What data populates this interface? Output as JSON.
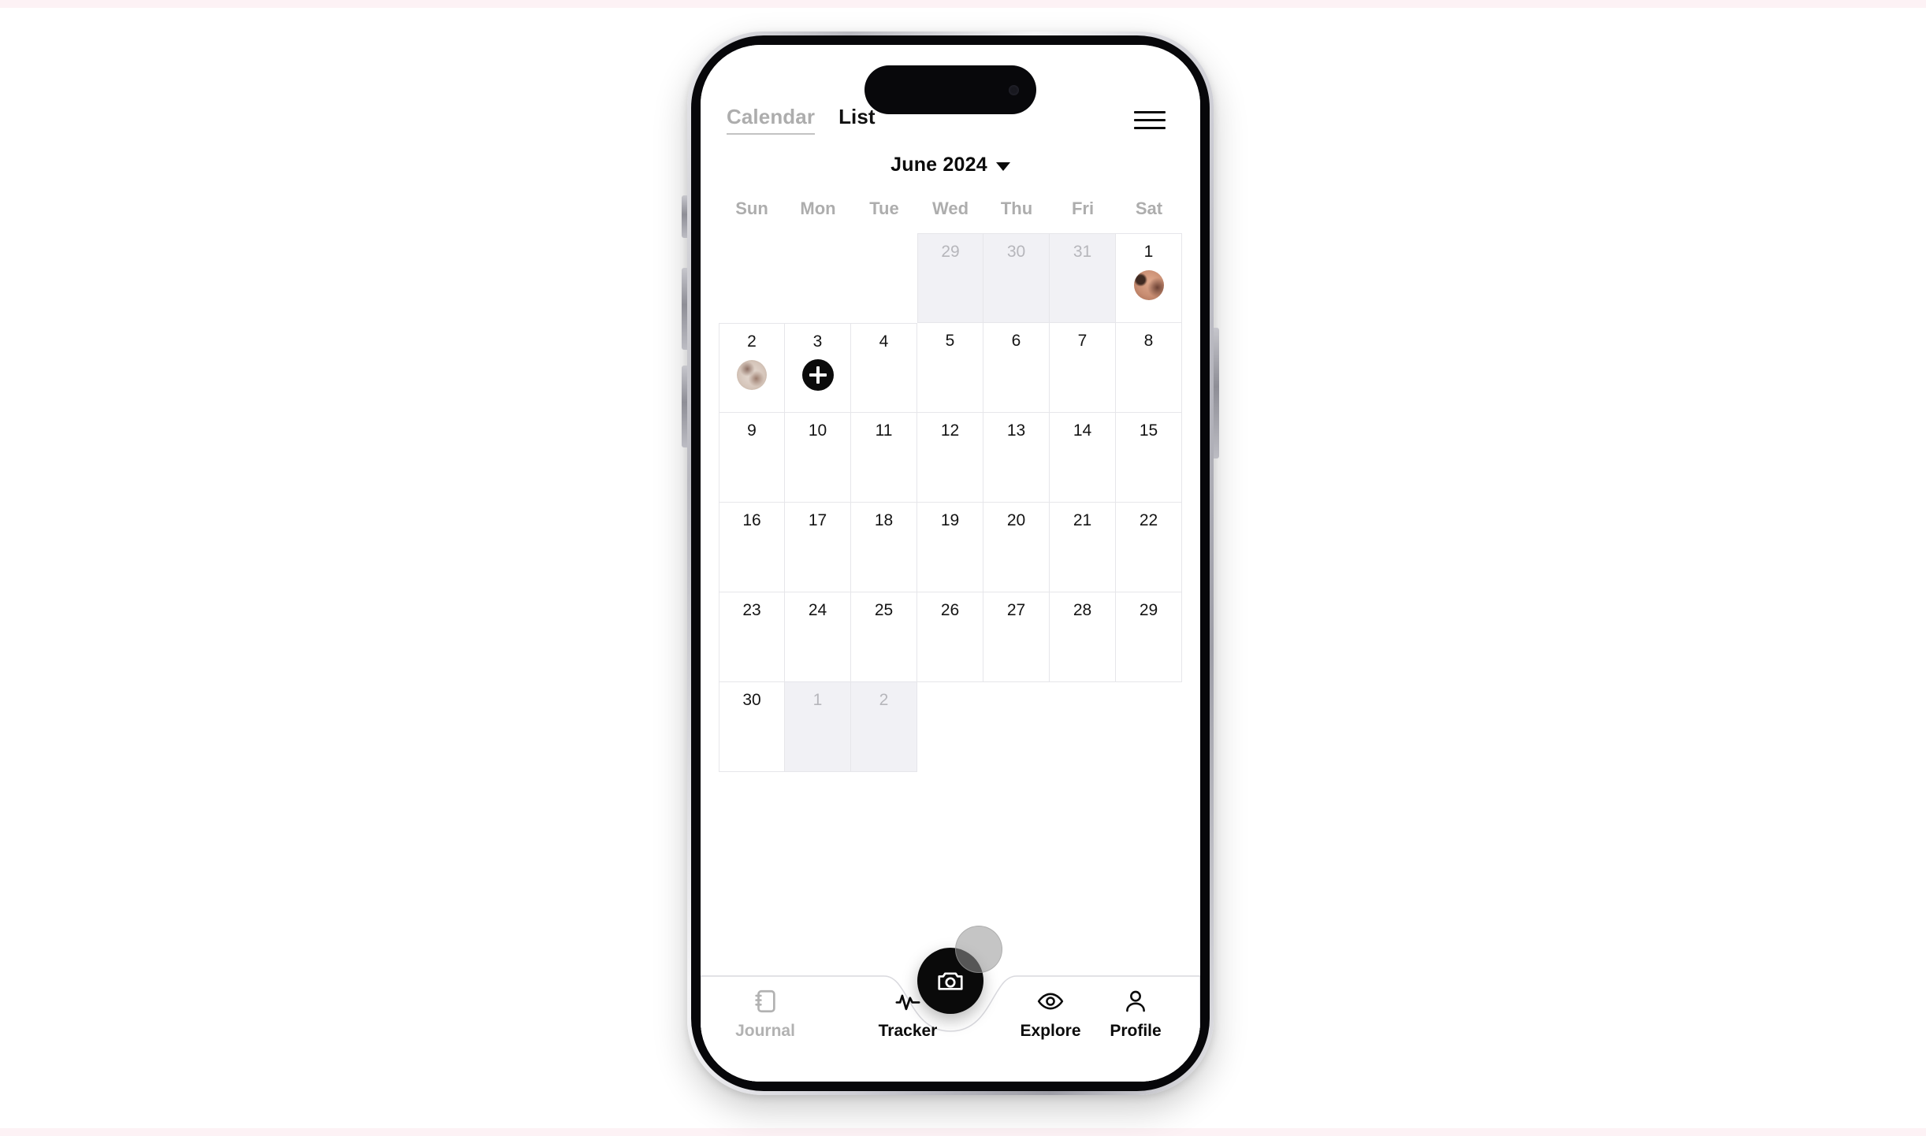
{
  "page": {
    "background": "#ffffff",
    "accent_strip_color": "#fdf2f5"
  },
  "device": {
    "type": "smartphone-mockup",
    "frame_color": "#07070a",
    "buttons": [
      "silent-switch",
      "volume-up",
      "volume-down",
      "power"
    ]
  },
  "header": {
    "tabs": [
      {
        "label": "Calendar",
        "active": false
      },
      {
        "label": "List",
        "active": true
      }
    ],
    "menu_icon": "hamburger-menu-icon"
  },
  "month_selector": {
    "label": "June 2024",
    "caret_icon": "chevron-down-icon"
  },
  "calendar": {
    "weekdays": [
      "Sun",
      "Mon",
      "Tue",
      "Wed",
      "Thu",
      "Fri",
      "Sat"
    ],
    "weeks": [
      [
        {
          "day": "",
          "type": "blank"
        },
        {
          "day": "",
          "type": "blank"
        },
        {
          "day": "",
          "type": "blank"
        },
        {
          "day": "29",
          "type": "outside"
        },
        {
          "day": "30",
          "type": "outside"
        },
        {
          "day": "31",
          "type": "outside"
        },
        {
          "day": "1",
          "type": "current",
          "content": "photo",
          "thumb": "thumb-a"
        }
      ],
      [
        {
          "day": "2",
          "type": "current",
          "content": "photo",
          "thumb": "thumb-b"
        },
        {
          "day": "3",
          "type": "current",
          "content": "add"
        },
        {
          "day": "4",
          "type": "current"
        },
        {
          "day": "5",
          "type": "current"
        },
        {
          "day": "6",
          "type": "current"
        },
        {
          "day": "7",
          "type": "current"
        },
        {
          "day": "8",
          "type": "current"
        }
      ],
      [
        {
          "day": "9",
          "type": "current"
        },
        {
          "day": "10",
          "type": "current"
        },
        {
          "day": "11",
          "type": "current"
        },
        {
          "day": "12",
          "type": "current"
        },
        {
          "day": "13",
          "type": "current"
        },
        {
          "day": "14",
          "type": "current"
        },
        {
          "day": "15",
          "type": "current"
        }
      ],
      [
        {
          "day": "16",
          "type": "current"
        },
        {
          "day": "17",
          "type": "current"
        },
        {
          "day": "18",
          "type": "current"
        },
        {
          "day": "19",
          "type": "current"
        },
        {
          "day": "20",
          "type": "current"
        },
        {
          "day": "21",
          "type": "current"
        },
        {
          "day": "22",
          "type": "current"
        }
      ],
      [
        {
          "day": "23",
          "type": "current"
        },
        {
          "day": "24",
          "type": "current"
        },
        {
          "day": "25",
          "type": "current"
        },
        {
          "day": "26",
          "type": "current"
        },
        {
          "day": "27",
          "type": "current"
        },
        {
          "day": "28",
          "type": "current"
        },
        {
          "day": "29",
          "type": "current"
        }
      ],
      [
        {
          "day": "30",
          "type": "current"
        },
        {
          "day": "1",
          "type": "outside"
        },
        {
          "day": "2",
          "type": "outside"
        },
        {
          "day": "",
          "type": "blank"
        },
        {
          "day": "",
          "type": "blank"
        },
        {
          "day": "",
          "type": "blank"
        },
        {
          "day": "",
          "type": "blank"
        }
      ]
    ],
    "add_button_icon": "plus-icon",
    "outside_day_bg": "#f1f1f5",
    "grid_line_color": "#e6e6ea"
  },
  "bottom_nav": {
    "items": [
      {
        "label": "Journal",
        "icon": "journal-icon",
        "active": false
      },
      {
        "label": "Tracker",
        "icon": "pulse-icon",
        "active": true
      },
      {
        "label": "Explore",
        "icon": "eye-icon",
        "active": true
      },
      {
        "label": "Profile",
        "icon": "person-icon",
        "active": true
      }
    ],
    "fab": {
      "icon": "camera-icon",
      "color": "#0a0a0a"
    },
    "cursor": {
      "shape": "circle",
      "color": "rgba(150,150,150,0.55)"
    }
  }
}
